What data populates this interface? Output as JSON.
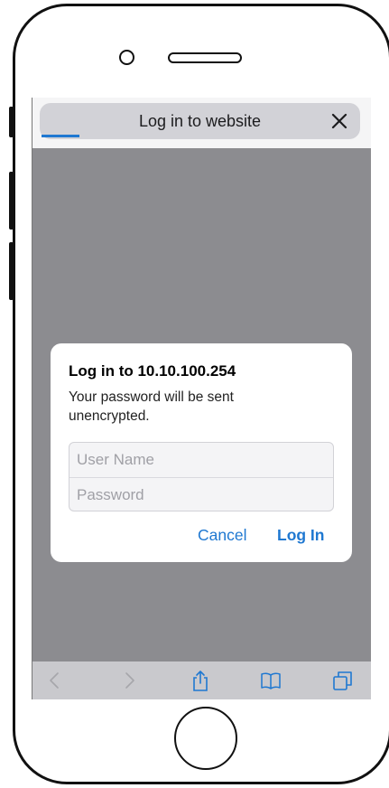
{
  "browser": {
    "title": "Log in to website",
    "close_icon": "close-icon"
  },
  "dialog": {
    "title": "Log in to 10.10.100.254",
    "message": "Your password will be sent unencrypted.",
    "username_placeholder": "User Name",
    "username_value": "",
    "password_placeholder": "Password",
    "password_value": "",
    "cancel_label": "Cancel",
    "login_label": "Log In"
  },
  "toolbar": {
    "icons": [
      "back-icon",
      "forward-icon",
      "share-icon",
      "bookmarks-icon",
      "tabs-icon"
    ]
  },
  "colors": {
    "accent": "#1f78d1",
    "overlay": "#8c8c90",
    "toolbar": "#c9c9cd"
  }
}
